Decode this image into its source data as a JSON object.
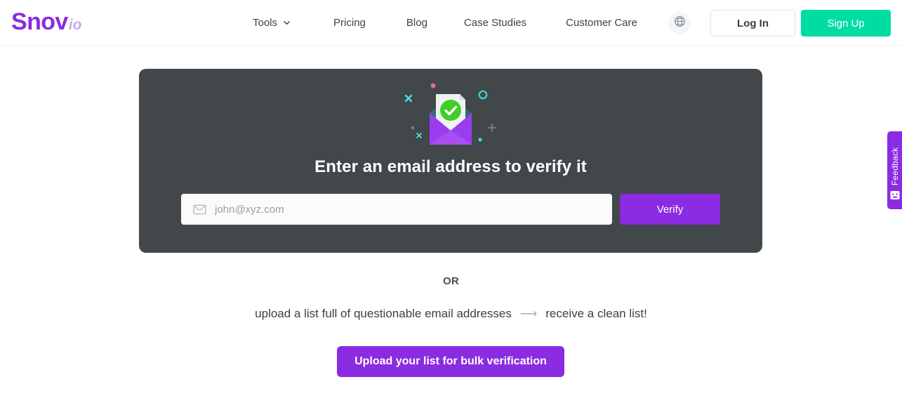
{
  "header": {
    "logo": {
      "main": "Snov",
      "suffix": "io"
    },
    "nav": [
      {
        "label": "Tools",
        "has_dropdown": true,
        "icon": "chevron-down-icon"
      },
      {
        "label": "Pricing",
        "has_dropdown": false
      },
      {
        "label": "Blog",
        "has_dropdown": false
      },
      {
        "label": "Case Studies",
        "has_dropdown": false
      },
      {
        "label": "Customer Care",
        "has_dropdown": false
      }
    ],
    "language_icon": "globe-icon",
    "login_label": "Log In",
    "signup_label": "Sign Up"
  },
  "hero": {
    "illustration": "envelope-verified-icon",
    "title": "Enter an email address to verify it",
    "input": {
      "icon": "mail-icon",
      "value": "",
      "placeholder": "john@xyz.com"
    },
    "verify_label": "Verify"
  },
  "alternative": {
    "divider_label": "OR",
    "tagline_before": "upload a list full of questionable email addresses",
    "tagline_arrow": "⟶",
    "tagline_after": "receive a clean list!",
    "upload_label": "Upload your list for bulk verification"
  },
  "feedback": {
    "label": "Feedback",
    "icon": "smiley-face-icon"
  },
  "colors": {
    "brand_purple": "#8b2be2",
    "logo_suffix_purple": "#c7a6ef",
    "signup_green": "#00dda2",
    "card_dark": "#424749",
    "check_green": "#3fce2a",
    "accent_cyan": "#4fe0e0",
    "accent_pink": "#e06ab0",
    "page_background": "#ffffff"
  }
}
